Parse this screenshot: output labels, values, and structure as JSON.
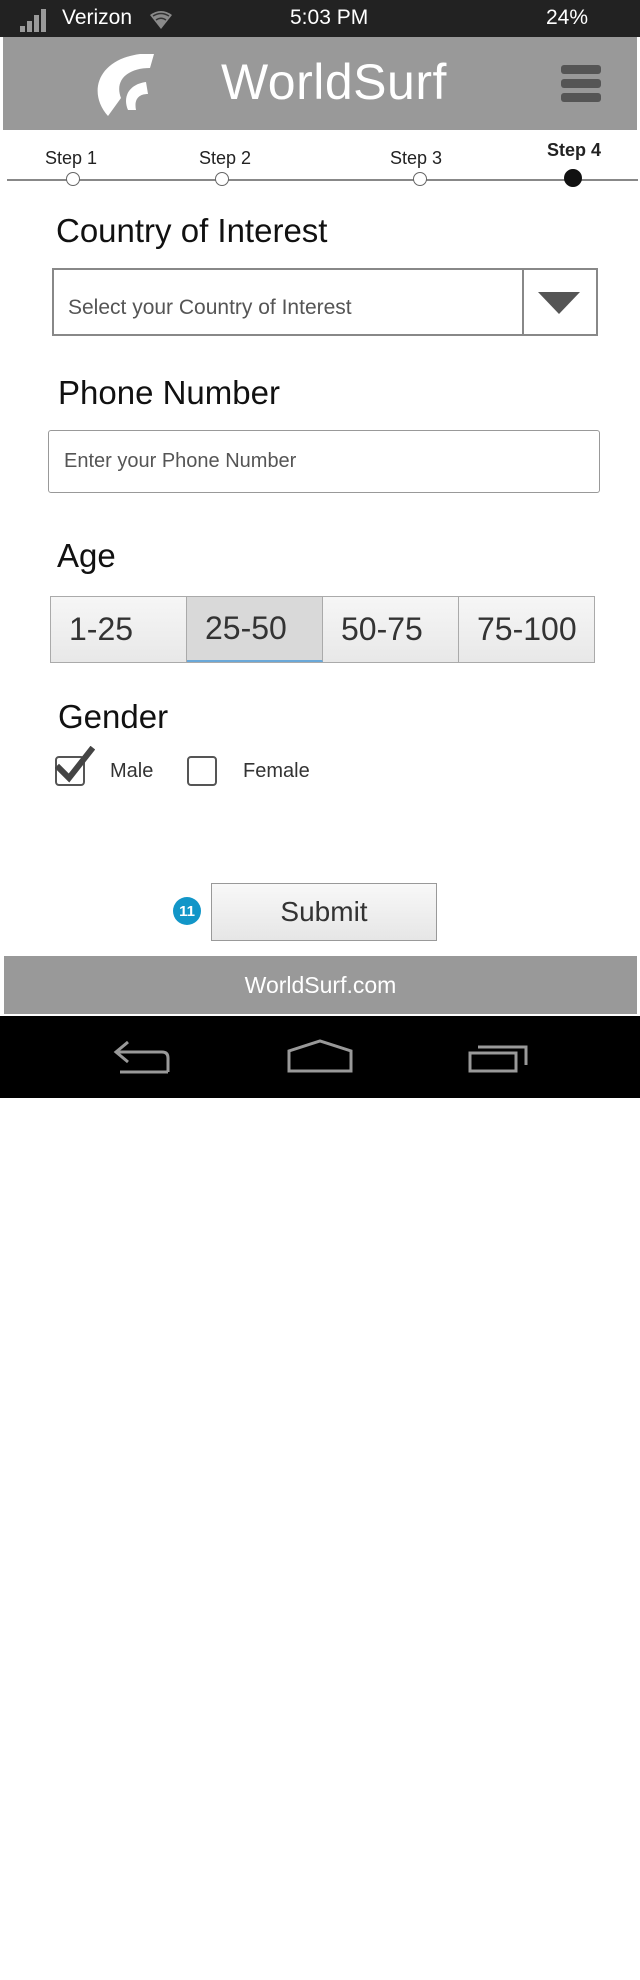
{
  "status_bar": {
    "carrier": "Verizon",
    "time": "5:03 PM",
    "battery": "24%",
    "icons": [
      "signal-icon",
      "wifi-icon"
    ]
  },
  "header": {
    "title": "WorldSurf",
    "logo_icon": "wave-logo-icon",
    "menu_icon": "hamburger-menu-icon",
    "background_color": "#999999"
  },
  "steps": [
    {
      "label": "Step 1",
      "active": false
    },
    {
      "label": "Step 2",
      "active": false
    },
    {
      "label": "Step 3",
      "active": false
    },
    {
      "label": "Step 4",
      "active": true
    }
  ],
  "country": {
    "title": "Country of Interest",
    "placeholder": "Select your Country of Interest",
    "dropdown_icon": "dropdown-arrow-icon"
  },
  "phone": {
    "title": "Phone Number",
    "placeholder": "Enter your Phone Number"
  },
  "age": {
    "title": "Age",
    "options": [
      "1-25",
      "25-50",
      "50-75",
      "75-100"
    ],
    "selected": "25-50"
  },
  "gender": {
    "title": "Gender",
    "options": [
      {
        "label": "Male",
        "checked": true
      },
      {
        "label": "Female",
        "checked": false
      }
    ]
  },
  "submit": {
    "badge": "11",
    "label": "Submit",
    "badge_color": "#1296c8"
  },
  "footer": {
    "text": "WorldSurf.com"
  },
  "nav_bar": {
    "icons": [
      "back-icon",
      "home-icon",
      "recent-apps-icon"
    ]
  }
}
